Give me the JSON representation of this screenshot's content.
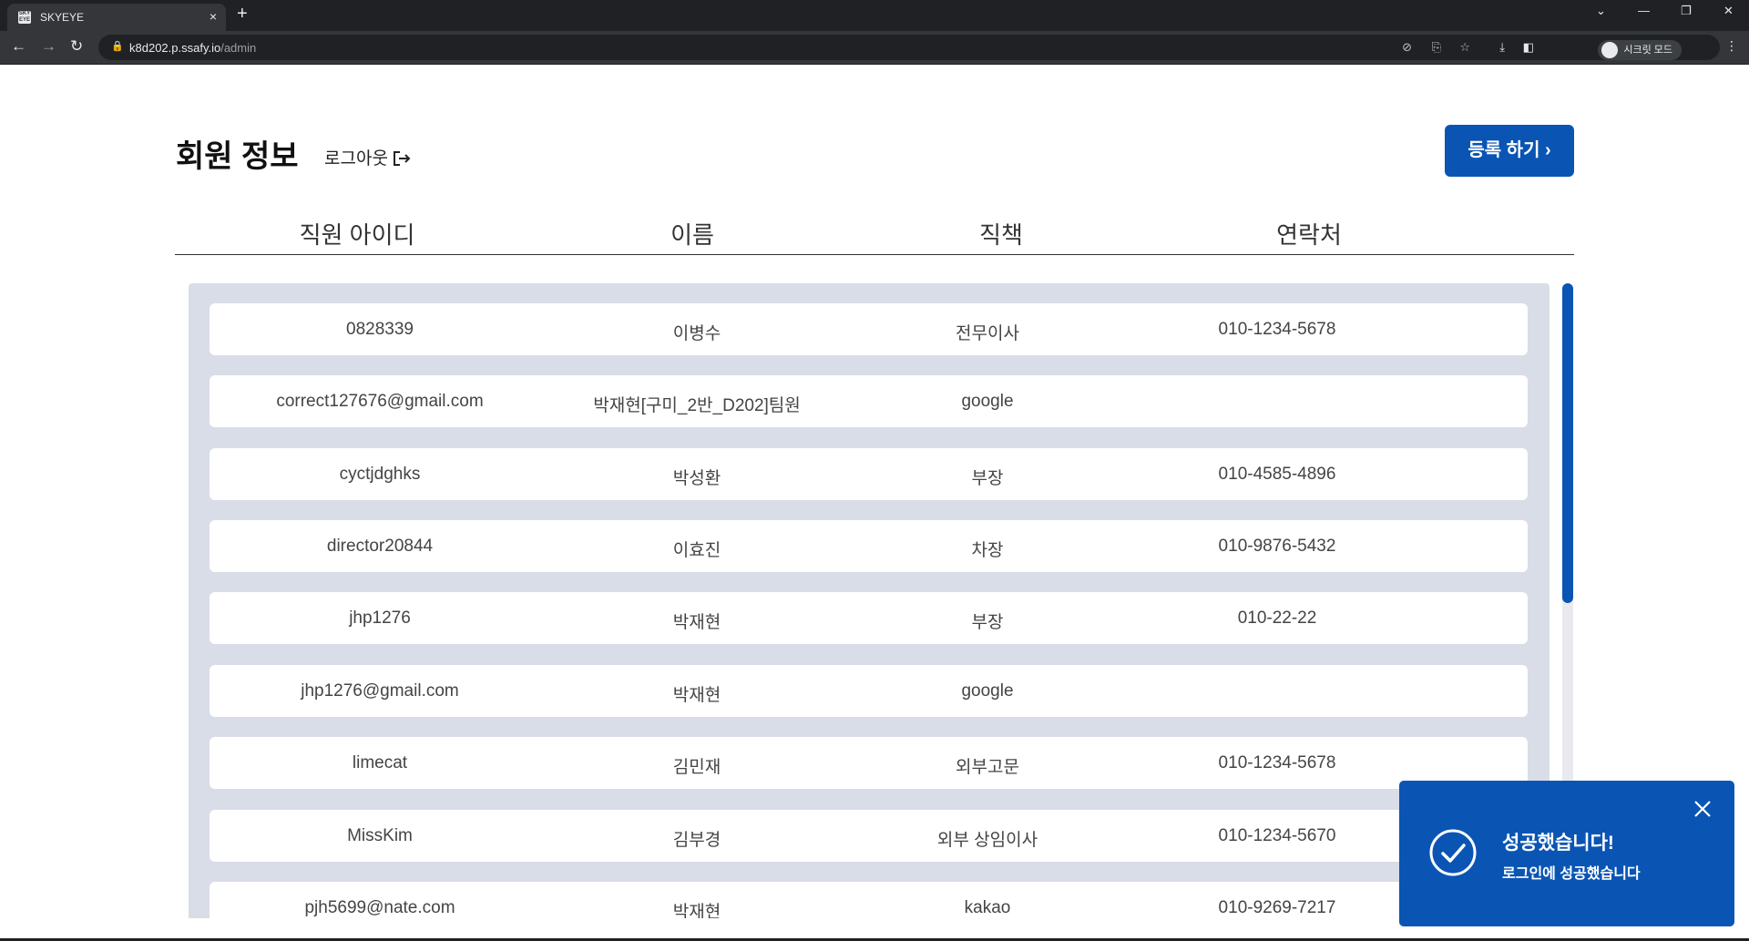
{
  "browser": {
    "tab_title": "SKYEYE",
    "favicon_text": "SKY EYE",
    "new_tab": "+",
    "tab_close": "×",
    "url_host": "k8d202.p.ssafy.io",
    "url_path": "/admin",
    "incognito_label": "시크릿 모드"
  },
  "page": {
    "title": "회원 정보",
    "logout_label": "로그아웃",
    "register_label": "등록 하기 ›"
  },
  "table": {
    "headers": [
      "직원 아이디",
      "이름",
      "직책",
      "연락처"
    ],
    "rows": [
      {
        "id": "0828339",
        "name": "이병수",
        "position": "전무이사",
        "phone": "010-1234-5678"
      },
      {
        "id": "correct127676@gmail.com",
        "name": "박재현[구미_2반_D202]팀원",
        "position": "google",
        "phone": ""
      },
      {
        "id": "cyctjdghks",
        "name": "박성환",
        "position": "부장",
        "phone": "010-4585-4896"
      },
      {
        "id": "director20844",
        "name": "이효진",
        "position": "차장",
        "phone": "010-9876-5432"
      },
      {
        "id": "jhp1276",
        "name": "박재현",
        "position": "부장",
        "phone": "010-22-22"
      },
      {
        "id": "jhp1276@gmail.com",
        "name": "박재현",
        "position": "google",
        "phone": ""
      },
      {
        "id": "limecat",
        "name": "김민재",
        "position": "외부고문",
        "phone": "010-1234-5678"
      },
      {
        "id": "MissKim",
        "name": "김부경",
        "position": "외부 상임이사",
        "phone": "010-1234-5670"
      },
      {
        "id": "pjh5699@nate.com",
        "name": "박재현",
        "position": "kakao",
        "phone": "010-9269-7217"
      }
    ]
  },
  "toast": {
    "title": "성공했습니다!",
    "message": "로그인에 성공했습니다"
  },
  "colors": {
    "accent": "#0a55b4",
    "list_bg": "#d9dde7"
  }
}
